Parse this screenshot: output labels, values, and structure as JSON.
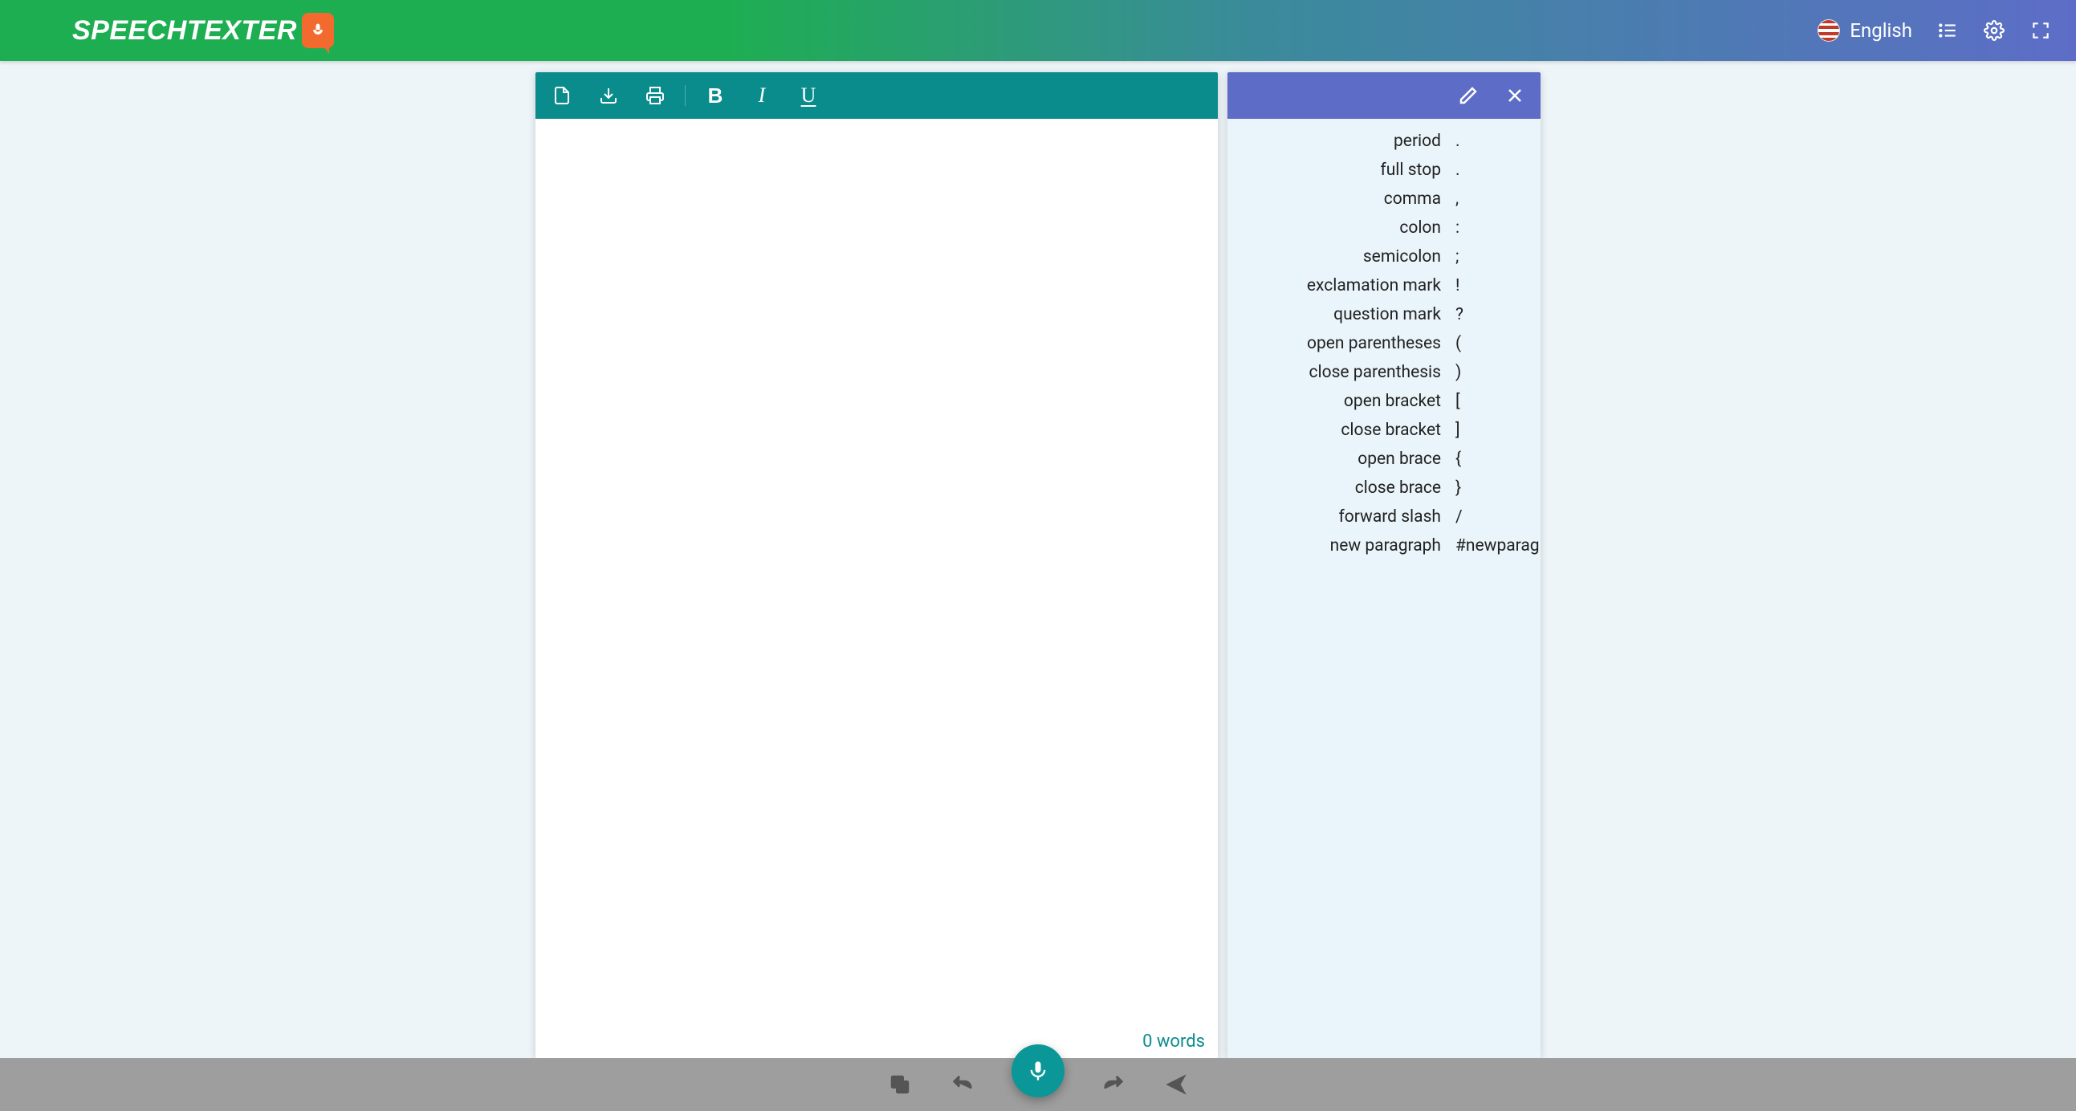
{
  "header": {
    "logo_text": "SPEECHTEXTER",
    "language": "English"
  },
  "editor": {
    "word_count": "0 words"
  },
  "commands": [
    {
      "name": "period",
      "symbol": "."
    },
    {
      "name": "full stop",
      "symbol": "."
    },
    {
      "name": "comma",
      "symbol": ","
    },
    {
      "name": "colon",
      "symbol": ":"
    },
    {
      "name": "semicolon",
      "symbol": ";"
    },
    {
      "name": "exclamation mark",
      "symbol": "!"
    },
    {
      "name": "question mark",
      "symbol": "?"
    },
    {
      "name": "open parentheses",
      "symbol": "("
    },
    {
      "name": "close parenthesis",
      "symbol": ")"
    },
    {
      "name": "open bracket",
      "symbol": "["
    },
    {
      "name": "close bracket",
      "symbol": "]"
    },
    {
      "name": "open brace",
      "symbol": "{"
    },
    {
      "name": "close brace",
      "symbol": "}"
    },
    {
      "name": "forward slash",
      "symbol": "/"
    },
    {
      "name": "new paragraph",
      "symbol": "#newparagraph"
    }
  ]
}
